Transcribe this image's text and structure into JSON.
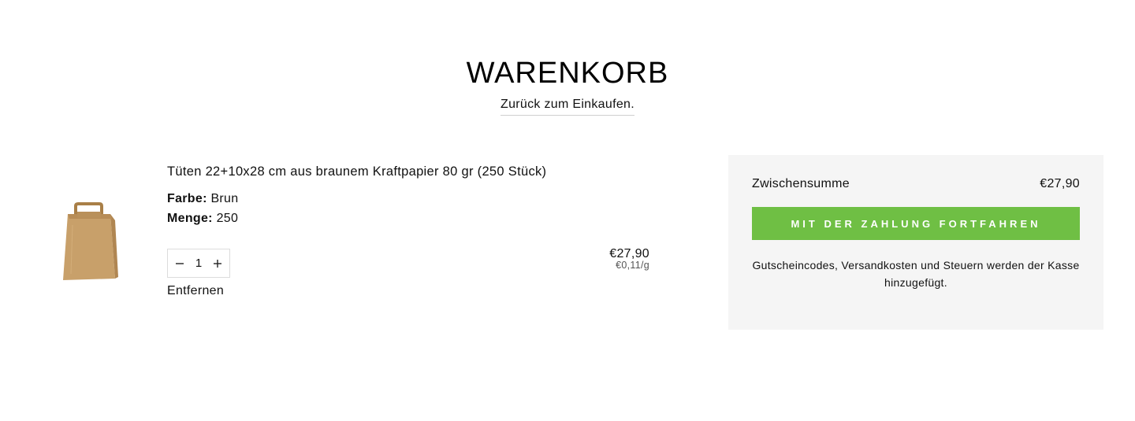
{
  "page": {
    "title": "WARENKORB",
    "back_link": "Zurück zum Einkaufen."
  },
  "item": {
    "title": "Tüten 22+10x28 cm aus braunem Kraftpapier 80 gr (250 Stück)",
    "color_label": "Farbe:",
    "color_value": "Brun",
    "qty_label": "Menge:",
    "qty_value": "250",
    "quantity": "1",
    "price": "€27,90",
    "unit_price": "€0,11/g",
    "remove_label": "Entfernen",
    "image_icon": "kraft-paper-bag"
  },
  "summary": {
    "subtotal_label": "Zwischensumme",
    "subtotal_value": "€27,90",
    "checkout_label": "MIT DER ZAHLUNG FORTFAHREN",
    "note": "Gutscheincodes, Versandkosten und Steuern werden der Kasse hinzugefügt."
  },
  "colors": {
    "accent": "#6fbf44",
    "summary_bg": "#f5f5f5",
    "bag": "#c8a06a"
  }
}
